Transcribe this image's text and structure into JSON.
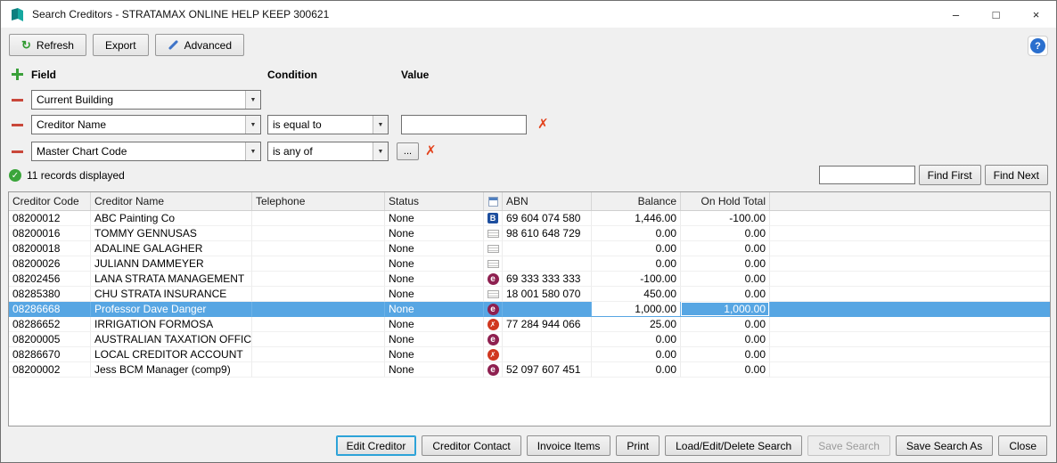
{
  "window": {
    "title": "Search Creditors - STRATAMAX ONLINE HELP KEEP 300621",
    "controls": {
      "minimize": "–",
      "maximize": "□",
      "close": "×"
    }
  },
  "toolbar": {
    "refresh": "Refresh",
    "export": "Export",
    "advanced": "Advanced",
    "help": "?"
  },
  "criteria": {
    "field_header": "Field",
    "condition_header": "Condition",
    "value_header": "Value",
    "rows": [
      {
        "field": "Current Building"
      },
      {
        "field": "Creditor Name",
        "condition": "is equal to",
        "value": ""
      },
      {
        "field": "Master Chart Code",
        "condition": "is any of",
        "picker": "..."
      }
    ]
  },
  "statusbar": {
    "records": "11 records displayed"
  },
  "find": {
    "value": "",
    "first": "Find First",
    "next": "Find Next"
  },
  "table": {
    "columns": {
      "code": "Creditor Code",
      "name": "Creditor Name",
      "telephone": "Telephone",
      "status": "Status",
      "abn": "ABN",
      "balance": "Balance",
      "onhold": "On Hold Total"
    },
    "rows": [
      {
        "code": "08200012",
        "name": "ABC Painting Co",
        "telephone": "",
        "status": "None",
        "icon": "bpay",
        "abn": "69 604 074 580",
        "balance": "1,446.00",
        "onhold": "-100.00",
        "selected": false
      },
      {
        "code": "08200016",
        "name": "TOMMY GENNUSAS",
        "telephone": "",
        "status": "None",
        "icon": "doc",
        "abn": "98 610 648 729",
        "balance": "0.00",
        "onhold": "0.00",
        "selected": false
      },
      {
        "code": "08200018",
        "name": "ADALINE GALAGHER",
        "telephone": "",
        "status": "None",
        "icon": "doc",
        "abn": "",
        "balance": "0.00",
        "onhold": "0.00",
        "selected": false
      },
      {
        "code": "08200026",
        "name": "JULIANN DAMMEYER",
        "telephone": "",
        "status": "None",
        "icon": "doc",
        "abn": "",
        "balance": "0.00",
        "onhold": "0.00",
        "selected": false
      },
      {
        "code": "08202456",
        "name": "LANA STRATA MANAGEMENT",
        "telephone": "",
        "status": "None",
        "icon": "e",
        "abn": "69 333 333 333",
        "balance": "-100.00",
        "onhold": "0.00",
        "selected": false
      },
      {
        "code": "08285380",
        "name": "CHU STRATA INSURANCE",
        "telephone": "",
        "status": "None",
        "icon": "doc",
        "abn": "18 001 580 070",
        "balance": "450.00",
        "onhold": "0.00",
        "selected": false
      },
      {
        "code": "08286668",
        "name": "Professor Dave Danger",
        "telephone": "",
        "status": "None",
        "icon": "e",
        "abn": "",
        "balance": "1,000.00",
        "onhold": "1,000.00",
        "selected": true
      },
      {
        "code": "08286652",
        "name": "IRRIGATION FORMOSA",
        "telephone": "",
        "status": "None",
        "icon": "x",
        "abn": "77 284 944 066",
        "balance": "25.00",
        "onhold": "0.00",
        "selected": false
      },
      {
        "code": "08200005",
        "name": "AUSTRALIAN TAXATION OFFICE",
        "telephone": "",
        "status": "None",
        "icon": "e",
        "abn": "",
        "balance": "0.00",
        "onhold": "0.00",
        "selected": false
      },
      {
        "code": "08286670",
        "name": "LOCAL CREDITOR ACCOUNT",
        "telephone": "",
        "status": "None",
        "icon": "x",
        "abn": "",
        "balance": "0.00",
        "onhold": "0.00",
        "selected": false
      },
      {
        "code": "08200002",
        "name": "Jess BCM Manager (comp9)",
        "telephone": "",
        "status": "None",
        "icon": "e",
        "abn": "52 097 607 451",
        "balance": "0.00",
        "onhold": "0.00",
        "selected": false
      }
    ]
  },
  "footer": {
    "edit_creditor": "Edit Creditor",
    "creditor_contact": "Creditor Contact",
    "invoice_items": "Invoice Items",
    "print": "Print",
    "load_edit_delete": "Load/Edit/Delete Search",
    "save_search": "Save Search",
    "save_search_as": "Save Search As",
    "close": "Close"
  },
  "colors": {
    "selection_blue": "#57a6e3",
    "bpay_blue": "#1d4e9e",
    "e_maroon": "#8e2050",
    "error_red": "#d0371f",
    "add_green": "#3aa03a",
    "remove_red": "#c9473a",
    "focus_border": "#2da3d8"
  }
}
